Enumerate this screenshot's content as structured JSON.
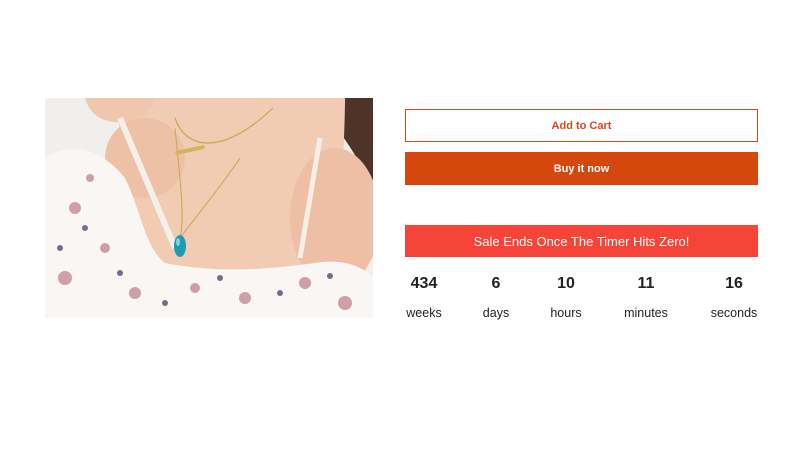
{
  "product": {
    "image_alt_icon": "necklace-photo"
  },
  "buttons": {
    "add_to_cart": "Add to Cart",
    "buy_now": "Buy it now"
  },
  "sale": {
    "banner": "Sale Ends Once The Timer Hits Zero!"
  },
  "countdown": {
    "weeks": {
      "value": "434",
      "label": "weeks"
    },
    "days": {
      "value": "6",
      "label": "days"
    },
    "hours": {
      "value": "10",
      "label": "hours"
    },
    "minutes": {
      "value": "11",
      "label": "minutes"
    },
    "seconds": {
      "value": "16",
      "label": "seconds"
    }
  },
  "colors": {
    "accent": "#d4470d",
    "banner": "#f64538",
    "text": "#222222"
  }
}
